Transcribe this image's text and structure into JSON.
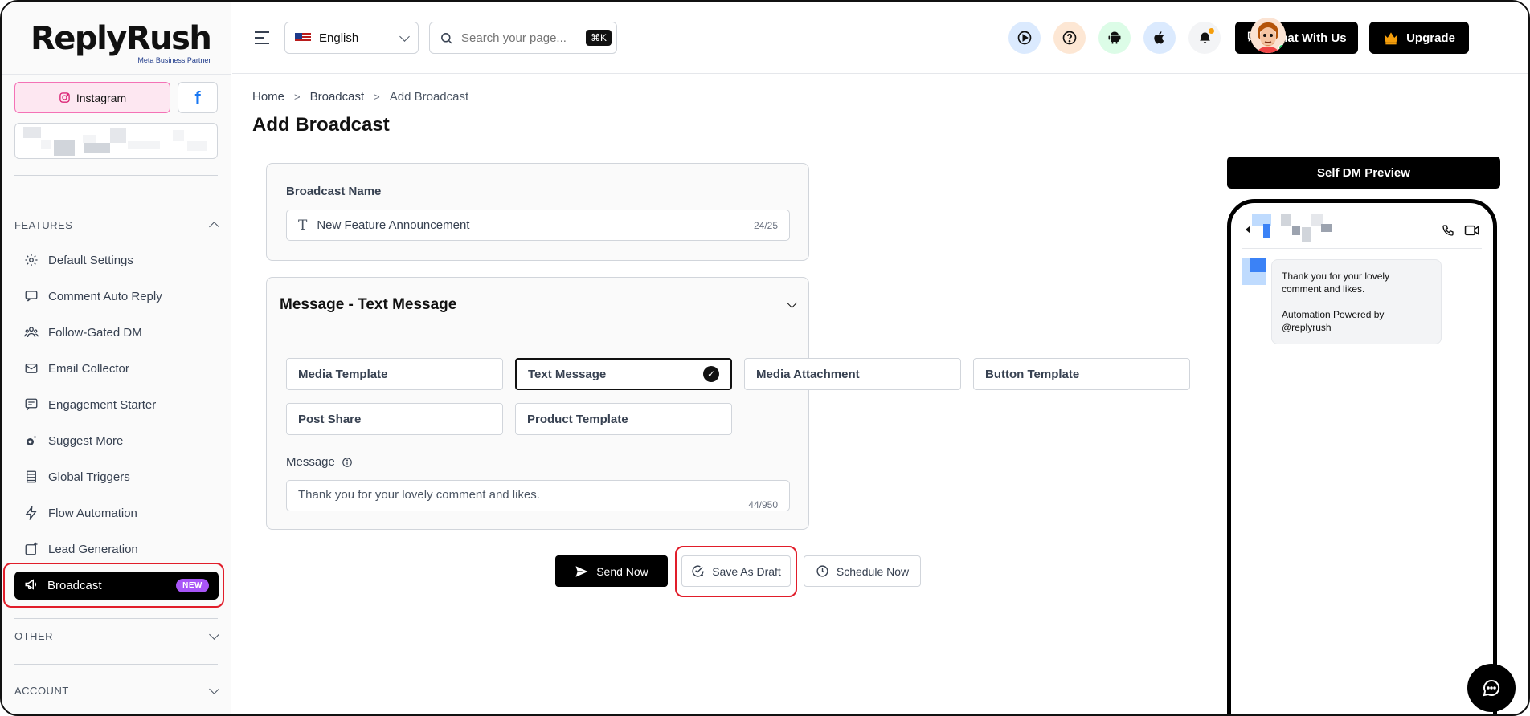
{
  "brand": {
    "name": "ReplyRush",
    "partner": "Meta Business Partner"
  },
  "platforms": {
    "instagram_label": "Instagram",
    "facebook_glyph": "f"
  },
  "sidebar": {
    "features_heading": "FEATURES",
    "items": [
      {
        "label": "Default Settings",
        "icon": "gear-icon"
      },
      {
        "label": "Comment Auto Reply",
        "icon": "comment-icon"
      },
      {
        "label": "Follow-Gated DM",
        "icon": "users-icon"
      },
      {
        "label": "Email Collector",
        "icon": "mail-icon"
      },
      {
        "label": "Engagement Starter",
        "icon": "chat-list-icon"
      },
      {
        "label": "Suggest More",
        "icon": "sparkle-gear-icon"
      },
      {
        "label": "Global Triggers",
        "icon": "stack-icon"
      },
      {
        "label": "Flow Automation",
        "icon": "lightning-icon"
      },
      {
        "label": "Lead Generation",
        "icon": "square-plus-icon"
      }
    ],
    "active_item": {
      "label": "Broadcast",
      "badge": "NEW",
      "icon": "megaphone-icon"
    },
    "other_heading": "OTHER",
    "account_heading": "ACCOUNT"
  },
  "topbar": {
    "language": "English",
    "search_placeholder": "Search your page...",
    "shortcut": "⌘K",
    "chat_label": "Chat With Us",
    "upgrade_label": "Upgrade"
  },
  "breadcrumb": {
    "home": "Home",
    "section": "Broadcast",
    "current": "Add Broadcast"
  },
  "page_title": "Add Broadcast",
  "broadcast_name": {
    "label": "Broadcast Name",
    "value": "New Feature Announcement",
    "count": "24/25"
  },
  "message_section": {
    "title": "Message - Text Message",
    "templates": [
      "Media Template",
      "Text Message",
      "Media Attachment",
      "Button Template",
      "Post Share",
      "Product Template"
    ],
    "selected_template": "Text Message",
    "message_label": "Message",
    "message_value": "Thank you for your lovely comment and likes.",
    "message_count": "44/950"
  },
  "actions": {
    "send": "Send Now",
    "draft": "Save As Draft",
    "schedule": "Schedule Now"
  },
  "preview": {
    "title": "Self DM Preview",
    "bubble_line1": "Thank you for your lovely comment and likes.",
    "bubble_line2": "Automation Powered by @replyrush"
  },
  "colors": {
    "accent": "#000000",
    "highlight": "#e11d2a",
    "badge": "#a855f7",
    "instagram_bg": "#fde7f1"
  }
}
